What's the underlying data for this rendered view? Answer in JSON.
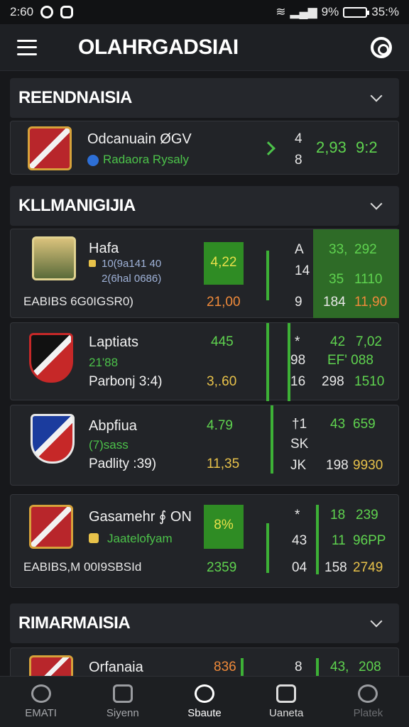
{
  "status_bar": {
    "time": "2:60",
    "right_text": "9%",
    "battery_pct": "35:%"
  },
  "app": {
    "title": "OLAHRGADSIAI"
  },
  "sections": [
    {
      "label": "REENDNAISIA"
    },
    {
      "label": "KLLMANIGIJIA"
    },
    {
      "label": "RIMARMAISIA"
    }
  ],
  "card1": {
    "name": "Odcanuain ØGV",
    "sub": "Radaora Rysaly",
    "s1": "4",
    "s2": "8",
    "v1": "2,93",
    "v2": "9:2"
  },
  "card2": {
    "name": "Hafa",
    "line1": "10(9a141 40",
    "line2": "2(6hal 0686)",
    "footer": "EABIBS 6G0IGSR0)",
    "box": "4,22",
    "odds": "21,00",
    "c1": "A",
    "c2": "14",
    "c3": "9",
    "r1a": "33,",
    "r1b": "292",
    "r2a": "35",
    "r2b": "1110",
    "r3a": "184",
    "r3b": "11,90"
  },
  "card3": {
    "name": "Laptiats",
    "sub": "21'88",
    "foot": "Parbonj 3:4)",
    "v1": "445",
    "v2": "3,.60",
    "c1": "*",
    "c2": "98",
    "c3": "16",
    "r1a": "42",
    "r1b": "7,02",
    "r2": "EF' 088",
    "r3a": "298",
    "r3b": "1510"
  },
  "card4": {
    "name": "Abpfiua",
    "sub": "(7)sass",
    "foot": "Padlity :39)",
    "v1": "4.79",
    "v2": "11,35",
    "c1": "†1",
    "c2": "SK",
    "c3": "JK",
    "r1a": "43",
    "r1b": "659",
    "r3a": "198",
    "r3b": "9930"
  },
  "card5": {
    "name": "Gasamehr ∮ ON",
    "sub": "Jaatelofyam",
    "footer": "EABIBS,M 00I9SBSId",
    "box": "8%",
    "v2": "2359",
    "c1": "*",
    "c2": "43",
    "c3": "04",
    "r1a": "18",
    "r1b": "239",
    "r2a": "11",
    "r2b": "96PP",
    "r3a": "158",
    "r3b": "2749"
  },
  "card6": {
    "name": "Orfanaia",
    "v1": "836",
    "c1": "8",
    "r1a": "43,",
    "r1b": "208"
  },
  "bottom_nav": [
    {
      "label": "EMATI"
    },
    {
      "label": "Siyenn"
    },
    {
      "label": "Sbaute"
    },
    {
      "label": "Uaneta"
    },
    {
      "label": "Platek"
    }
  ]
}
